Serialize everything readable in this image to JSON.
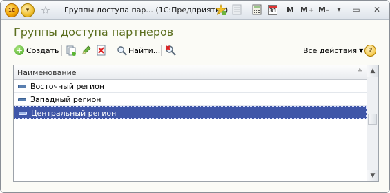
{
  "window": {
    "title": "Группы доступа пар...   (1С:Предприятие)",
    "logo_text": "1С",
    "menu_glyph": "▾",
    "favorite_glyph": "☆",
    "icons": [
      "favorites-add-icon",
      "history-icon",
      "calculator-icon",
      "calendar-icon"
    ],
    "calendar_text": "31",
    "m_buttons": [
      "M",
      "M+",
      "M-"
    ],
    "minimize_glyph": "▾",
    "restore_glyph": "▭",
    "close_glyph": "✕"
  },
  "form": {
    "heading": "Группы доступа партнеров"
  },
  "toolbar": {
    "create_label": "Создать",
    "find_label": "Найти...",
    "all_actions_label": "Все действия",
    "help_glyph": "?"
  },
  "table": {
    "column_header": "Наименование",
    "rows": [
      {
        "name": "Восточный регион",
        "selected": false
      },
      {
        "name": "Западный регион",
        "selected": false
      },
      {
        "name": "Центральный регион",
        "selected": true
      }
    ]
  },
  "colors": {
    "heading": "#5b6e1e",
    "selection": "#3f56a8"
  }
}
